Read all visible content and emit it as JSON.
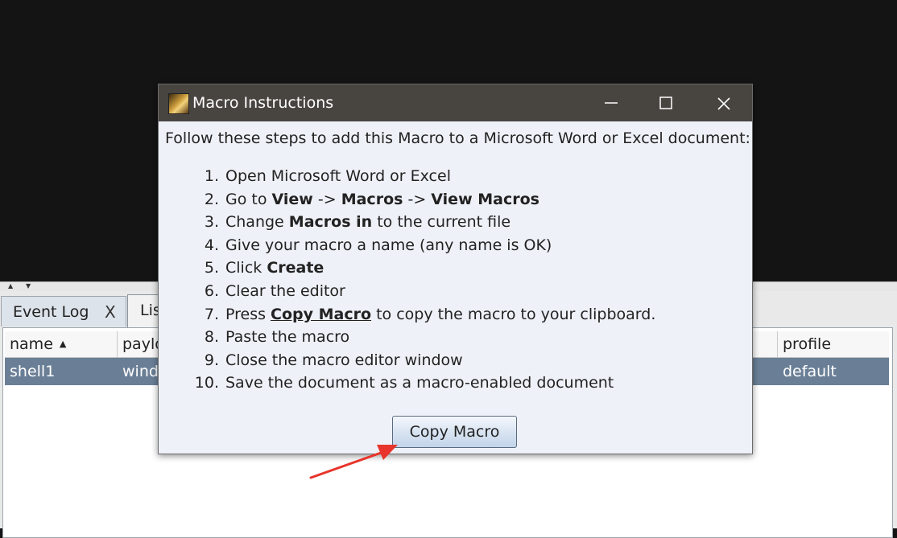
{
  "background_app": {
    "tabs": [
      {
        "label": "Event Log",
        "close_label": "X"
      },
      {
        "label": "Lis"
      }
    ],
    "table": {
      "columns": [
        {
          "label": "name",
          "sort_indicator": "▲"
        },
        {
          "label": "paylo"
        },
        {
          "label": "profile"
        }
      ],
      "rows": [
        {
          "name": "shell1",
          "payload": "windo",
          "profile": "default"
        }
      ]
    },
    "split_handle": {
      "up": "▲",
      "down": "▼"
    }
  },
  "dialog": {
    "title": "Macro Instructions",
    "window_buttons": {
      "minimize": "—",
      "maximize": "☐",
      "close": "✕"
    },
    "intro": "Follow these steps to add this Macro to a Microsoft Word or Excel document:",
    "steps": [
      {
        "num": "1.",
        "parts": [
          {
            "t": "Open Microsoft Word or Excel"
          }
        ]
      },
      {
        "num": "2.",
        "parts": [
          {
            "t": "Go to "
          },
          {
            "t": "View",
            "b": true
          },
          {
            "t": " -> "
          },
          {
            "t": "Macros",
            "b": true
          },
          {
            "t": " -> "
          },
          {
            "t": "View Macros",
            "b": true
          }
        ]
      },
      {
        "num": "3.",
        "parts": [
          {
            "t": "Change "
          },
          {
            "t": "Macros in",
            "b": true
          },
          {
            "t": " to the current file"
          }
        ]
      },
      {
        "num": "4.",
        "parts": [
          {
            "t": "Give your macro a name (any name is OK)"
          }
        ]
      },
      {
        "num": "5.",
        "parts": [
          {
            "t": "Click "
          },
          {
            "t": "Create",
            "b": true
          }
        ]
      },
      {
        "num": "6.",
        "parts": [
          {
            "t": "Clear the editor"
          }
        ]
      },
      {
        "num": "7.",
        "parts": [
          {
            "t": "Press "
          },
          {
            "t": "Copy Macro",
            "b": true,
            "u": true
          },
          {
            "t": " to copy the macro to your clipboard."
          }
        ]
      },
      {
        "num": "8.",
        "parts": [
          {
            "t": "Paste the macro"
          }
        ]
      },
      {
        "num": "9.",
        "parts": [
          {
            "t": "Close the macro editor window"
          }
        ]
      },
      {
        "num": "10.",
        "parts": [
          {
            "t": "Save the document as a macro-enabled document"
          }
        ]
      }
    ],
    "copy_button_label": "Copy Macro"
  },
  "colors": {
    "annotation_arrow": "#e8342a",
    "titlebar": "#484541",
    "selected_row": "#6a7f96"
  }
}
